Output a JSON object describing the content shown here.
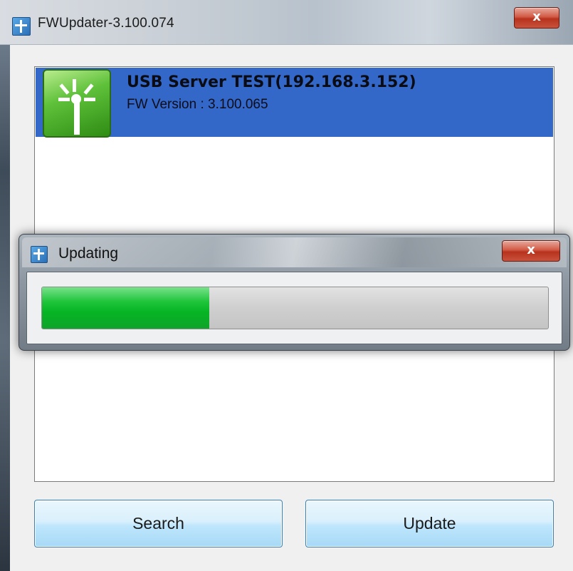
{
  "main_window": {
    "title": "FWUpdater-3.100.074",
    "close_label": "x"
  },
  "device_list": {
    "items": [
      {
        "name": "USB Server TEST(192.168.3.152)",
        "fw_version": "FW Version : 3.100.065",
        "selected": true,
        "icon": "antenna-icon"
      }
    ]
  },
  "buttons": {
    "search_label": "Search",
    "update_label": "Update"
  },
  "update_dialog": {
    "title": "Updating",
    "close_label": "x",
    "progress_fraction": 0.33
  },
  "colors": {
    "selection": "#3368c9",
    "progress_fill": "#06b524",
    "close_button": "#c8412b"
  }
}
